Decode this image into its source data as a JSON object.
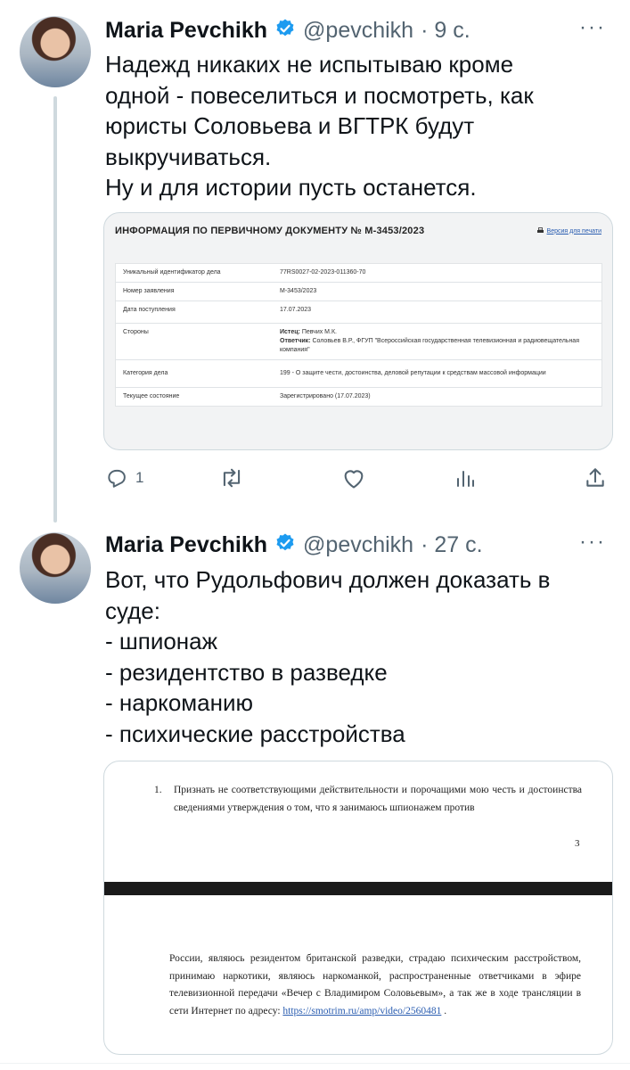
{
  "tweets": [
    {
      "author": "Maria Pevchikh",
      "handle": "@pevchikh",
      "time": "· 9 с.",
      "more": "···",
      "text": "Надежд никаких не испытываю кроме\nодной - повеселиться и посмотреть, как\nюристы Соловьева и ВГТРК будут\nвыкручиваться.\nНу и для истории пусть останется.",
      "document": {
        "title": "ИНФОРМАЦИЯ ПО ПЕРВИЧНОМУ ДОКУМЕНТУ № М-3453/2023",
        "print_link": "Версия для печати",
        "rows": [
          {
            "label": "Уникальный идентификатор дела",
            "value": "77RS0027-02-2023-011360-70"
          },
          {
            "label": "Номер заявления",
            "value": "М-3453/2023"
          },
          {
            "label": "Дата поступления",
            "value": "17.07.2023"
          },
          {
            "label": "Стороны",
            "plaintiff_label": "Истец:",
            "plaintiff": "Певчих М.К.",
            "defendant_label": "Ответчик:",
            "defendant": "Соловьев В.Р., ФГУП \"Всероссийская государственная телевизионная и радиовещательная компания\""
          },
          {
            "label": "Категория дела",
            "value": "199 - О защите чести, достоинства, деловой репутации к средствам массовой информации"
          },
          {
            "label": "Текущее состояние",
            "value": "Зарегистрировано (17.07.2023)"
          }
        ]
      },
      "actions": {
        "reply_count": "1"
      }
    },
    {
      "author": "Maria Pevchikh",
      "handle": "@pevchikh",
      "time": "· 27 с.",
      "more": "···",
      "text": "Вот, что Рудольфович должен доказать в\nсуде:\n- шпионаж\n- резидентство в разведке\n- наркоманию\n- психические расстройства",
      "legal": {
        "item_number": "1.",
        "para1": "Признать не соответствующими действительности и порочащими мою честь и достоинства сведениями утверждения о том, что я занимаюсь шпионажем против",
        "page_number": "3",
        "para2": "России, являюсь резидентом британской разведки, страдаю психическим расстройством, принимаю наркотики, являюсь наркоманкой, распространенные ответчиками в эфире телевизионной передачи «Вечер с Владимиром Соловьевым», а так же в ходе трансляции в сети Интернет по адресу:",
        "link": "https://smotrim.ru/amp/video/2560481",
        "link_suffix": "."
      }
    }
  ],
  "colors": {
    "verified": "#1d9bf0",
    "muted": "#536471",
    "text": "#0f1419",
    "link": "#2a5db0"
  },
  "icons": [
    "verified-badge-icon",
    "reply-icon",
    "retweet-icon",
    "like-icon",
    "views-icon",
    "share-icon"
  ]
}
